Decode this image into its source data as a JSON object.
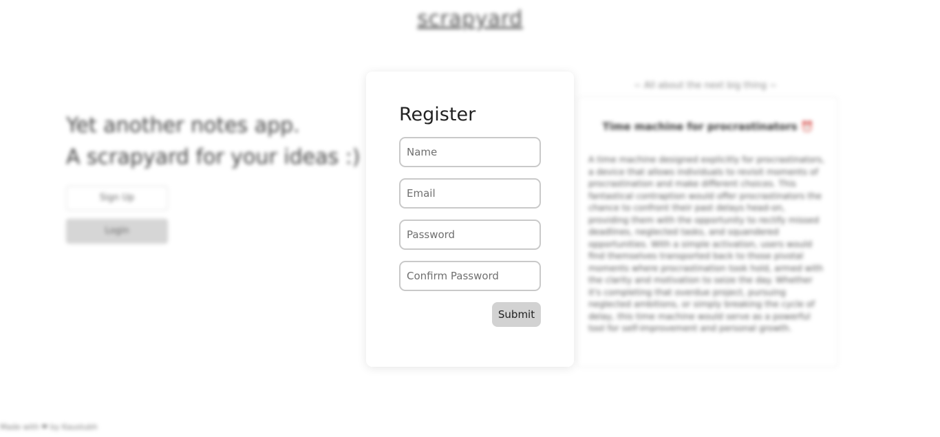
{
  "app": {
    "logo": "scrapyard"
  },
  "hero": {
    "line1": "Yet another notes app.",
    "line2": "A scrapyard for your ideas :)",
    "signup_label": "Sign Up",
    "login_label": "Login"
  },
  "aside": {
    "caption": "~ All about the next big thing ~",
    "card_title": "Time machine for procrastinators",
    "card_emoji": "⏰",
    "card_body": "A time machine designed explicitly for procrastinators, a device that allows individuals to revisit moments of procrastination and make different choices. This fantastical contraption would offer procrastinators the chance to confront their past delays head-on, providing them with the opportunity to rectify missed deadlines, neglected tasks, and squandered opportunities. With a simple activation, users would find themselves transported back to those pivotal moments where procrastination took hold, armed with the clarity and motivation to seize the day. Whether it's completing that overdue project, pursuing neglected ambitions, or simply breaking the cycle of delay, this time machine would serve as a powerful tool for self-improvement and personal growth."
  },
  "footer": {
    "text": "Made with ❤ by Kaustubh"
  },
  "register": {
    "title": "Register",
    "name_placeholder": "Name",
    "email_placeholder": "Email",
    "password_placeholder": "Password",
    "confirm_password_placeholder": "Confirm Password",
    "submit_label": "Submit"
  },
  "colors": {
    "submit_bg": "#d2d2d2",
    "field_border": "#c9c9c9",
    "login_bg": "#d6d6d6"
  }
}
